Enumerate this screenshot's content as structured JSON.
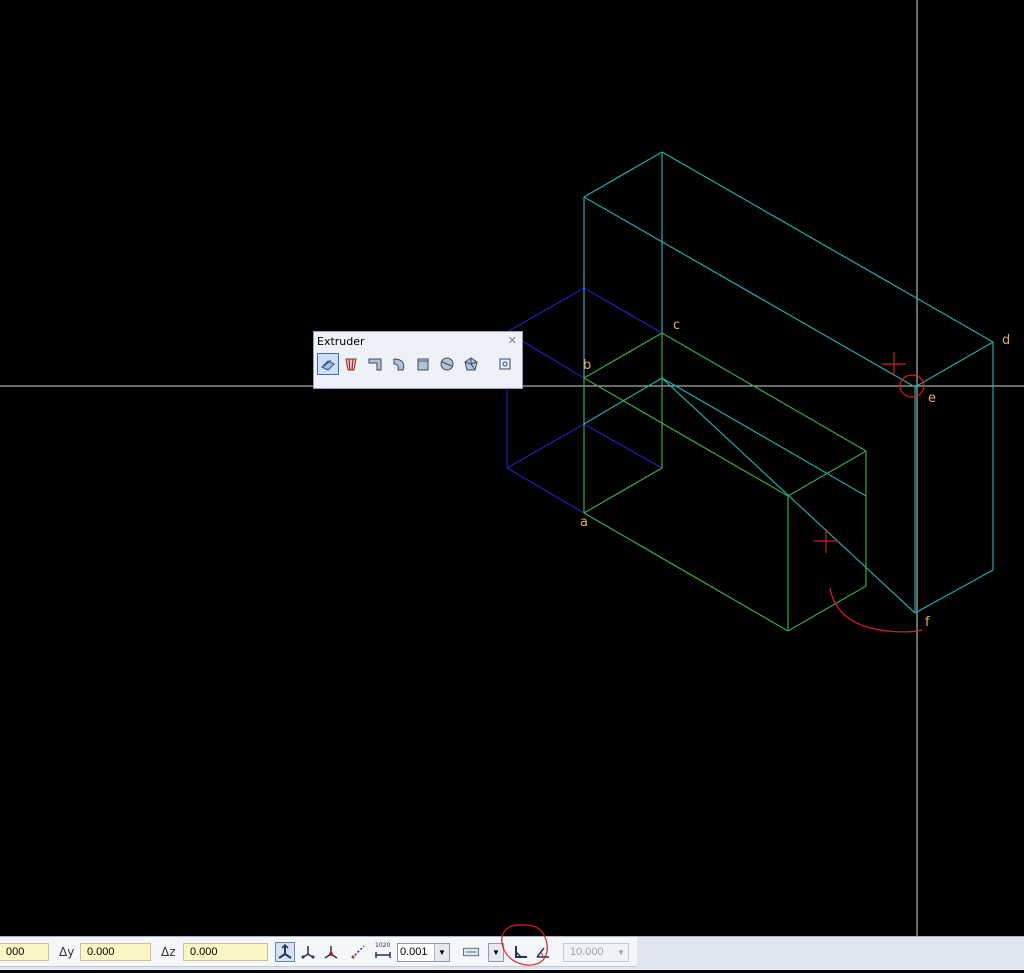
{
  "viewport": {
    "point_labels": {
      "a": "a",
      "b": "b",
      "c": "c",
      "d": "d",
      "e": "e",
      "f": "f"
    },
    "colors": {
      "background": "#000000",
      "teal_box": "#2aa7a7",
      "green_box": "#3aa84a",
      "blue_box": "#2020b8",
      "crosshair": "#cfd6dc",
      "annotation": "#d42020",
      "label": "#e0b060"
    }
  },
  "extruder": {
    "title": "Extruder",
    "close_icon": "close-icon",
    "tools": [
      "extrude-along-path-icon",
      "frustum-icon",
      "sweep-icon",
      "revolve-icon",
      "box-icon",
      "sphere-icon",
      "polyhedron-icon",
      "settings-icon"
    ]
  },
  "statusbar": {
    "dx_value": "000",
    "dy_label": "Δy",
    "dy_value": "0.000",
    "dz_label": "Δz",
    "dz_value": "0.000",
    "scale_caption": "1020",
    "tolerance_value": "0.001",
    "angle_value": "10.000",
    "icons": [
      "track-point-icon",
      "delta-point-icon",
      "intersect-point-icon",
      "line-dashed-icon",
      "dimension-icon",
      "layout-icon",
      "angle-snap-icon",
      "angle-rotate-icon"
    ]
  }
}
